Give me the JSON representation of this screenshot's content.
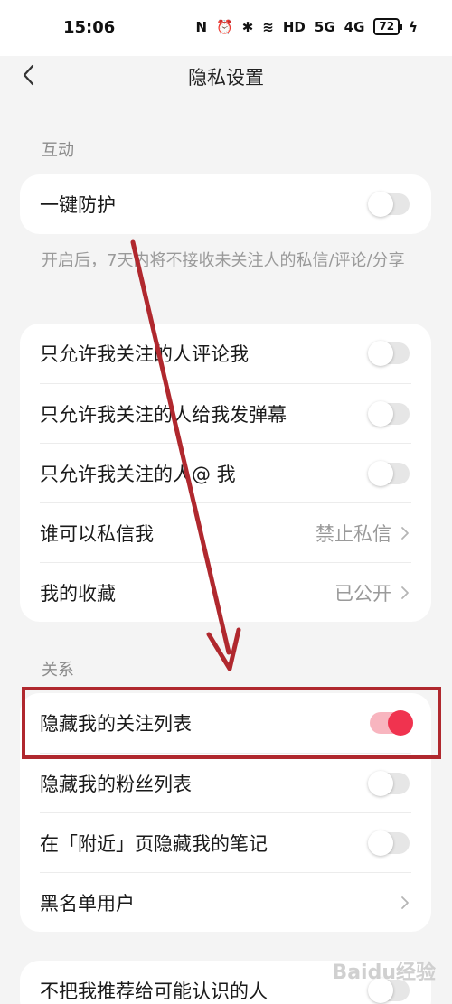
{
  "status_bar": {
    "time": "15:06",
    "network": "HD",
    "signal1": "5G",
    "signal2": "4G",
    "battery": "72"
  },
  "nav": {
    "title": "隐私设置"
  },
  "sections": {
    "interaction_label": "互动",
    "relation_label": "关系"
  },
  "one_click_protection": {
    "label": "一键防护",
    "enabled": false,
    "hint": "开启后，7天内将不接收未关注人的私信/评论/分享"
  },
  "interaction_items": [
    {
      "label": "只允许我关注的人评论我",
      "enabled": false
    },
    {
      "label": "只允许我关注的人给我发弹幕",
      "enabled": false
    },
    {
      "label": "只允许我关注的人@ 我",
      "enabled": false
    },
    {
      "label": "谁可以私信我",
      "value": "禁止私信"
    },
    {
      "label": "我的收藏",
      "value": "已公开"
    }
  ],
  "relation_items": [
    {
      "label": "隐藏我的关注列表",
      "enabled": true
    },
    {
      "label": "隐藏我的粉丝列表",
      "enabled": false
    },
    {
      "label": "在「附近」页隐藏我的笔记",
      "enabled": false
    },
    {
      "label": "黑名单用户"
    }
  ],
  "recommend_item": {
    "label": "不把我推荐给可能认识的人"
  },
  "watermark": "Baidu经验",
  "colors": {
    "accent": "#f0334f",
    "annotation": "#b0282e"
  }
}
